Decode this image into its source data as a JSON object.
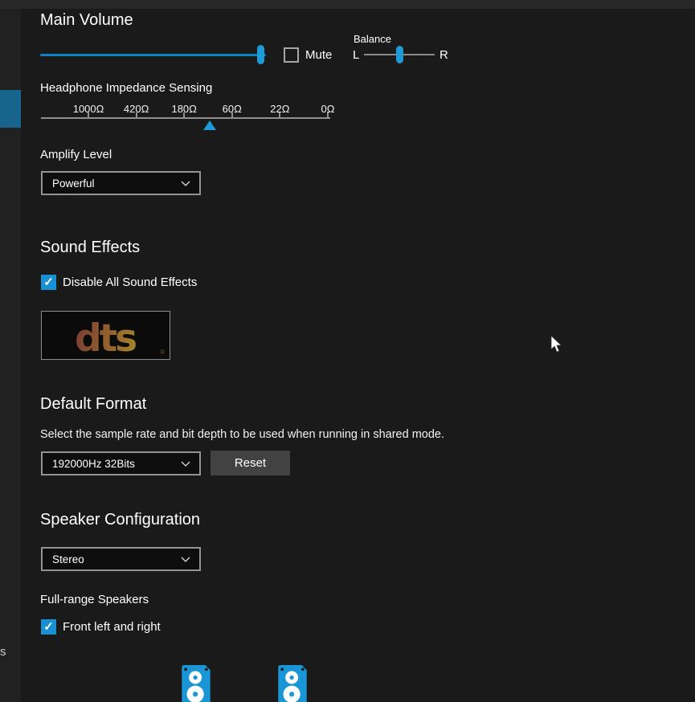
{
  "window": {
    "sidebar_fragment": "s"
  },
  "colors": {
    "accent": "#1e9ad6",
    "accent_checkbox": "#1791d3",
    "sidebar_accent": "#17658c",
    "background": "#1a1a1a"
  },
  "main_volume": {
    "title": "Main Volume",
    "volume_percent": 98,
    "mute_label": "Mute",
    "mute_checked": false,
    "balance_label": "Balance",
    "balance_left": "L",
    "balance_right": "R",
    "balance_percent": 50
  },
  "impedance": {
    "label": "Headphone Impedance Sensing",
    "ticks": [
      "1000Ω",
      "420Ω",
      "180Ω",
      "60Ω",
      "22Ω",
      "0Ω"
    ],
    "marker_percent": 58.3
  },
  "amplify": {
    "label": "Amplify Level",
    "value": "Powerful"
  },
  "sound_effects": {
    "title": "Sound Effects",
    "disable_label": "Disable All Sound Effects",
    "disable_checked": true,
    "dts_text": "dts",
    "dts_mark": "®"
  },
  "default_format": {
    "title": "Default Format",
    "description": "Select the sample rate and bit depth to be used when running in shared mode.",
    "value": "192000Hz 32Bits",
    "reset_label": "Reset"
  },
  "speaker_config": {
    "title": "Speaker Configuration",
    "value": "Stereo",
    "fullrange_label": "Full-range Speakers",
    "front_label": "Front left and right",
    "front_checked": true
  }
}
